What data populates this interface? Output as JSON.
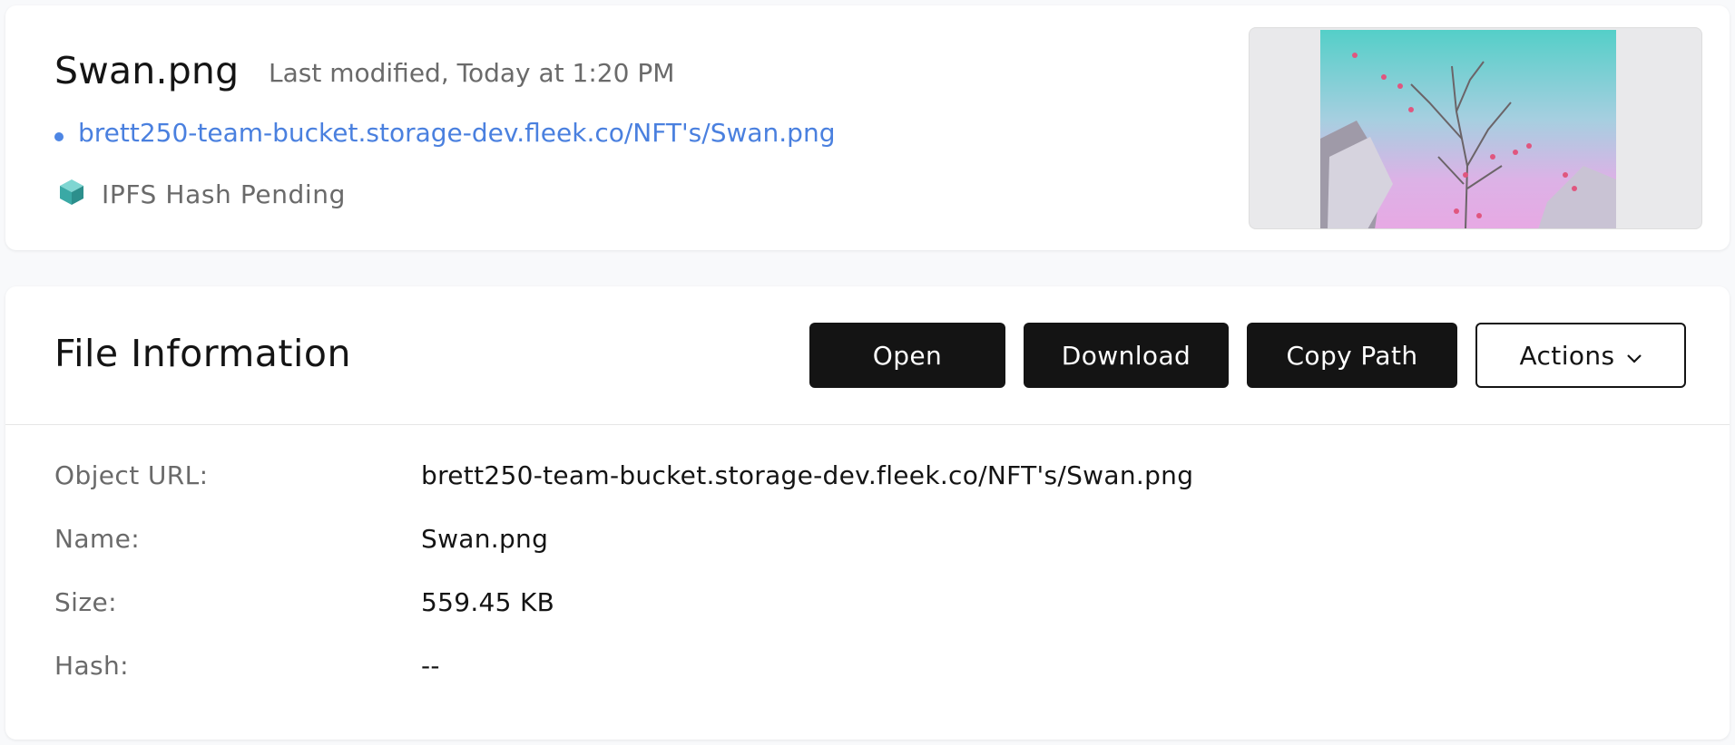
{
  "file": {
    "name": "Swan.png",
    "last_modified": "Last modified, Today at 1:20 PM",
    "url": "brett250-team-bucket.storage-dev.fleek.co/NFT's/Swan.png",
    "ipfs_status": "IPFS Hash Pending",
    "preview_icon": "image-thumbnail"
  },
  "file_info": {
    "title": "File Information",
    "buttons": {
      "open": "Open",
      "download": "Download",
      "copy_path": "Copy Path",
      "actions": "Actions"
    },
    "rows": [
      {
        "label": "Object URL:",
        "value": "brett250-team-bucket.storage-dev.fleek.co/NFT's/Swan.png"
      },
      {
        "label": "Name:",
        "value": "Swan.png"
      },
      {
        "label": "Size:",
        "value": "559.45 KB"
      },
      {
        "label": "Hash:",
        "value": "--"
      }
    ]
  },
  "colors": {
    "link": "#4a80df",
    "button_dark": "#141414",
    "ipfs_cube": "#3fb6b2"
  }
}
